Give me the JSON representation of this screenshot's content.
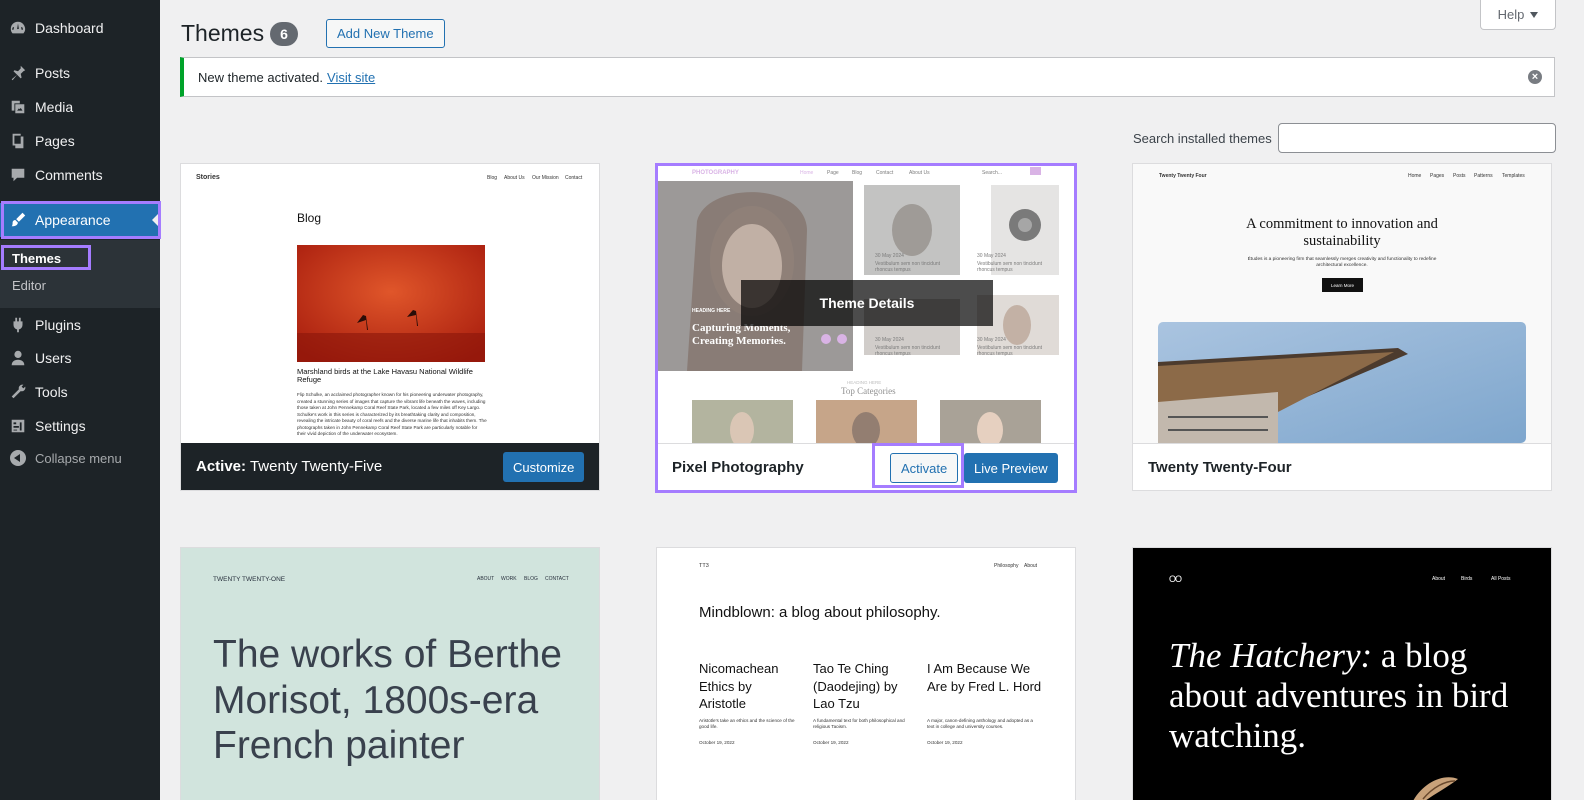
{
  "sidebar": {
    "items": [
      {
        "label": "Dashboard",
        "icon": "dashboard-icon"
      },
      {
        "label": "Posts",
        "icon": "pin-icon"
      },
      {
        "label": "Media",
        "icon": "media-icon"
      },
      {
        "label": "Pages",
        "icon": "pages-icon"
      },
      {
        "label": "Comments",
        "icon": "comment-icon"
      },
      {
        "label": "Appearance",
        "icon": "brush-icon"
      },
      {
        "label": "Plugins",
        "icon": "plugin-icon"
      },
      {
        "label": "Users",
        "icon": "user-icon"
      },
      {
        "label": "Tools",
        "icon": "wrench-icon"
      },
      {
        "label": "Settings",
        "icon": "settings-icon"
      }
    ],
    "submenu": [
      "Themes",
      "Editor"
    ],
    "collapse_label": "Collapse menu"
  },
  "header": {
    "title": "Themes",
    "count": "6",
    "add_new_label": "Add New Theme",
    "help_label": "Help"
  },
  "notice": {
    "text": "New theme activated.",
    "link": "Visit site"
  },
  "search": {
    "label": "Search installed themes",
    "value": ""
  },
  "themes": {
    "active": {
      "prefix": "Active:",
      "name": "Twenty Twenty-Five",
      "customize_label": "Customize",
      "preview": {
        "site_title": "Stories",
        "nav": [
          "Blog",
          "About Us",
          "Our Mission",
          "Contact"
        ],
        "heading": "Blog",
        "caption": "Marshland birds at the Lake Havasu National Wildlife Refuge",
        "body": "Flip Schulke, an acclaimed photographer known for his pioneering underwater photography, created a stunning series of images that capture the vibrant life beneath the waves, including those taken at John Pennekamp Coral Reef State Park, located a few miles off Key Largo. Schulke's work in this series is characterized by its breathtaking clarity and composition, revealing the intricate beauty of coral reefs and the diverse marine life that inhabits them. The photographs taken in John Pennekamp Coral Reef State Park are particularly notable for their vivid depiction of the underwater ecosystem."
      }
    },
    "pixel": {
      "name": "Pixel Photography",
      "details_label": "Theme Details",
      "activate_label": "Activate",
      "live_preview_label": "Live Preview",
      "preview": {
        "logo": "PHOTOGRAPHY",
        "nav": [
          "Home",
          "Page",
          "Blog",
          "Contact",
          "About Us"
        ],
        "search": "Search...",
        "kicker": "HEADING HERE",
        "hero": "Capturing Moments, Creating Memories.",
        "date": "30 May 2024",
        "excerpt": "Vestibulum sem non tincidunt rhoncus tempus",
        "section_kicker": "HEADING HERE",
        "section_title": "Top Categories"
      }
    },
    "tt4": {
      "name": "Twenty Twenty-Four",
      "preview": {
        "site_title": "Twenty Twenty Four",
        "nav": [
          "Home",
          "Pages",
          "Posts",
          "Patterns",
          "Templates"
        ],
        "headline": "A commitment to innovation and sustainability",
        "sub": "Études is a pioneering firm that seamlessly merges creativity and functionality to redefine architectural excellence.",
        "button": "Learn More"
      }
    },
    "tt1": {
      "preview": {
        "site_title": "TWENTY TWENTY-ONE",
        "nav": [
          "ABOUT",
          "WORK",
          "BLOG",
          "CONTACT"
        ],
        "headline": "The works of Berthe Morisot, 1800s-era French painter"
      }
    },
    "tt3": {
      "preview": {
        "site_title": "TT3",
        "nav": [
          "Philosophy",
          "About"
        ],
        "headline": "Mindblown: a blog about philosophy.",
        "posts": [
          {
            "title": "Nicomachean Ethics by Aristotle",
            "excerpt": "Aristotle's take an ethics and the science of the good life.",
            "date": "October 19, 2022"
          },
          {
            "title": "Tao Te Ching (Daodejing) by Lao Tzu",
            "excerpt": "A fundamental text for both philosophical and religious Taoism.",
            "date": "October 19, 2022"
          },
          {
            "title": "I Am Because We Are by Fred L. Hord",
            "excerpt": "A major, canon-defining anthology and adopted as a text in college and university courses.",
            "date": "October 19, 2022"
          }
        ]
      }
    },
    "hatchery": {
      "preview": {
        "logo": "OO",
        "nav": [
          "About",
          "Birds",
          "All Posts"
        ],
        "headline_italic": "The Hatchery:",
        "headline": "a blog about adventures in bird watching."
      }
    }
  },
  "colors": {
    "sidebar_bg": "#1d2327",
    "accent": "#2271b1",
    "highlight": "#a57cff",
    "notice_border": "#00a32a"
  }
}
